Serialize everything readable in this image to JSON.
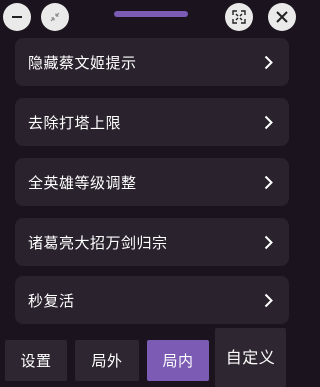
{
  "header": {
    "minimize_icon": "minus-icon",
    "collapse_icon": "shrink-arrows-icon",
    "expand_icon": "expand-arrows-icon",
    "close_icon": "close-icon",
    "handle_color": "#7b5bb3"
  },
  "menu": {
    "items": [
      {
        "label": "隐藏蔡文姬提示"
      },
      {
        "label": "去除打塔上限"
      },
      {
        "label": "全英雄等级调整"
      },
      {
        "label": "诸葛亮大招万剑归宗"
      },
      {
        "label": "秒复活"
      }
    ]
  },
  "tabs": [
    {
      "label": "设置",
      "active": false
    },
    {
      "label": "局外",
      "active": false
    },
    {
      "label": "局内",
      "active": true
    },
    {
      "label": "自定义",
      "active": false
    }
  ],
  "colors": {
    "background": "#1b141e",
    "item_bg": "#2a232e",
    "accent": "#7b5bb3"
  }
}
